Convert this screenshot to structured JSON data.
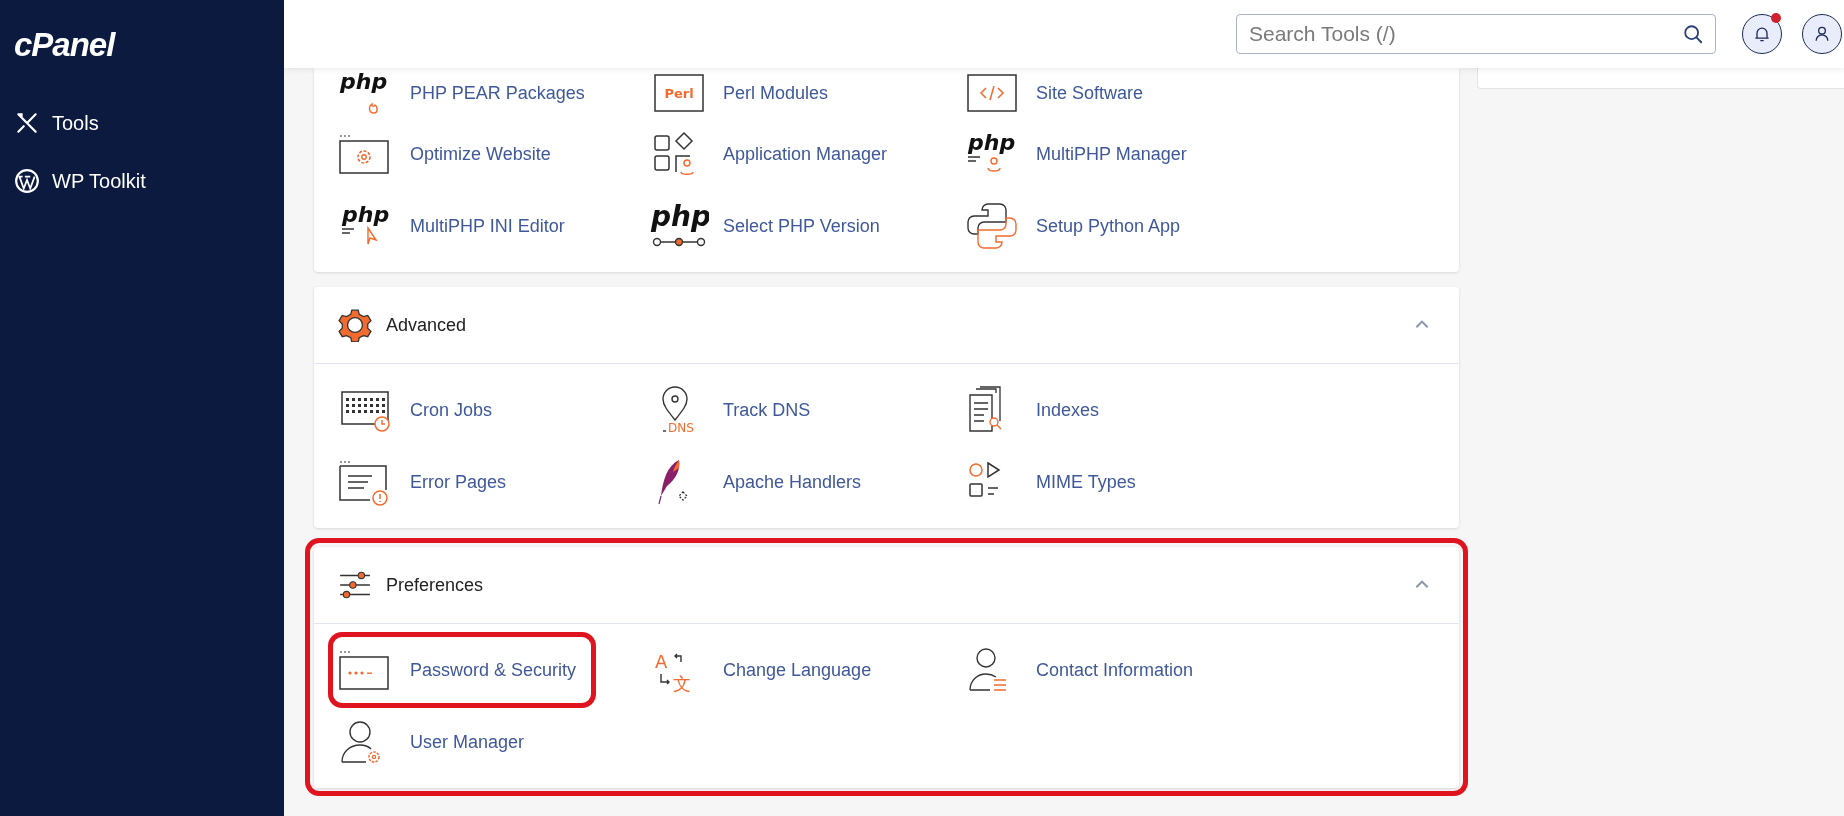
{
  "sidebar": {
    "logo": "cPanel",
    "items": [
      {
        "label": "Tools"
      },
      {
        "label": "WP Toolkit"
      }
    ]
  },
  "header": {
    "search": {
      "placeholder": "Search Tools (/)"
    },
    "notifications": {
      "unread": true
    }
  },
  "sections": [
    {
      "highlighted": false,
      "items": [
        {
          "label": "PHP PEAR Packages",
          "highlighted": false,
          "icon_texts": [
            "php"
          ]
        },
        {
          "label": "Perl Modules",
          "highlighted": false,
          "icon_texts": [
            "Perl"
          ]
        },
        {
          "label": "Site Software",
          "highlighted": false
        },
        {
          "label": "Optimize Website",
          "highlighted": false
        },
        {
          "label": "Application Manager",
          "highlighted": false
        },
        {
          "label": "MultiPHP Manager",
          "highlighted": false,
          "icon_texts": [
            "php"
          ]
        },
        {
          "label": "MultiPHP INI Editor",
          "highlighted": false,
          "icon_texts": [
            "php"
          ]
        },
        {
          "label": "Select PHP Version",
          "highlighted": false,
          "icon_texts": [
            "php"
          ]
        },
        {
          "label": "Setup Python App",
          "highlighted": false
        }
      ]
    },
    {
      "title": "Advanced",
      "expanded": true,
      "highlighted": false,
      "items": [
        {
          "label": "Cron Jobs",
          "highlighted": false
        },
        {
          "label": "Track DNS",
          "highlighted": false,
          "icon_texts": [
            "DNS"
          ]
        },
        {
          "label": "Indexes",
          "highlighted": false
        },
        {
          "label": "Error Pages",
          "highlighted": false
        },
        {
          "label": "Apache Handlers",
          "highlighted": false
        },
        {
          "label": "MIME Types",
          "highlighted": false
        }
      ]
    },
    {
      "title": "Preferences",
      "expanded": true,
      "highlighted": true,
      "items": [
        {
          "label": "Password & Security",
          "highlighted": true
        },
        {
          "label": "Change Language",
          "highlighted": false,
          "icon_texts": [
            "A",
            "文"
          ]
        },
        {
          "label": "Contact Information",
          "highlighted": false
        },
        {
          "label": "User Manager",
          "highlighted": false
        }
      ]
    }
  ]
}
